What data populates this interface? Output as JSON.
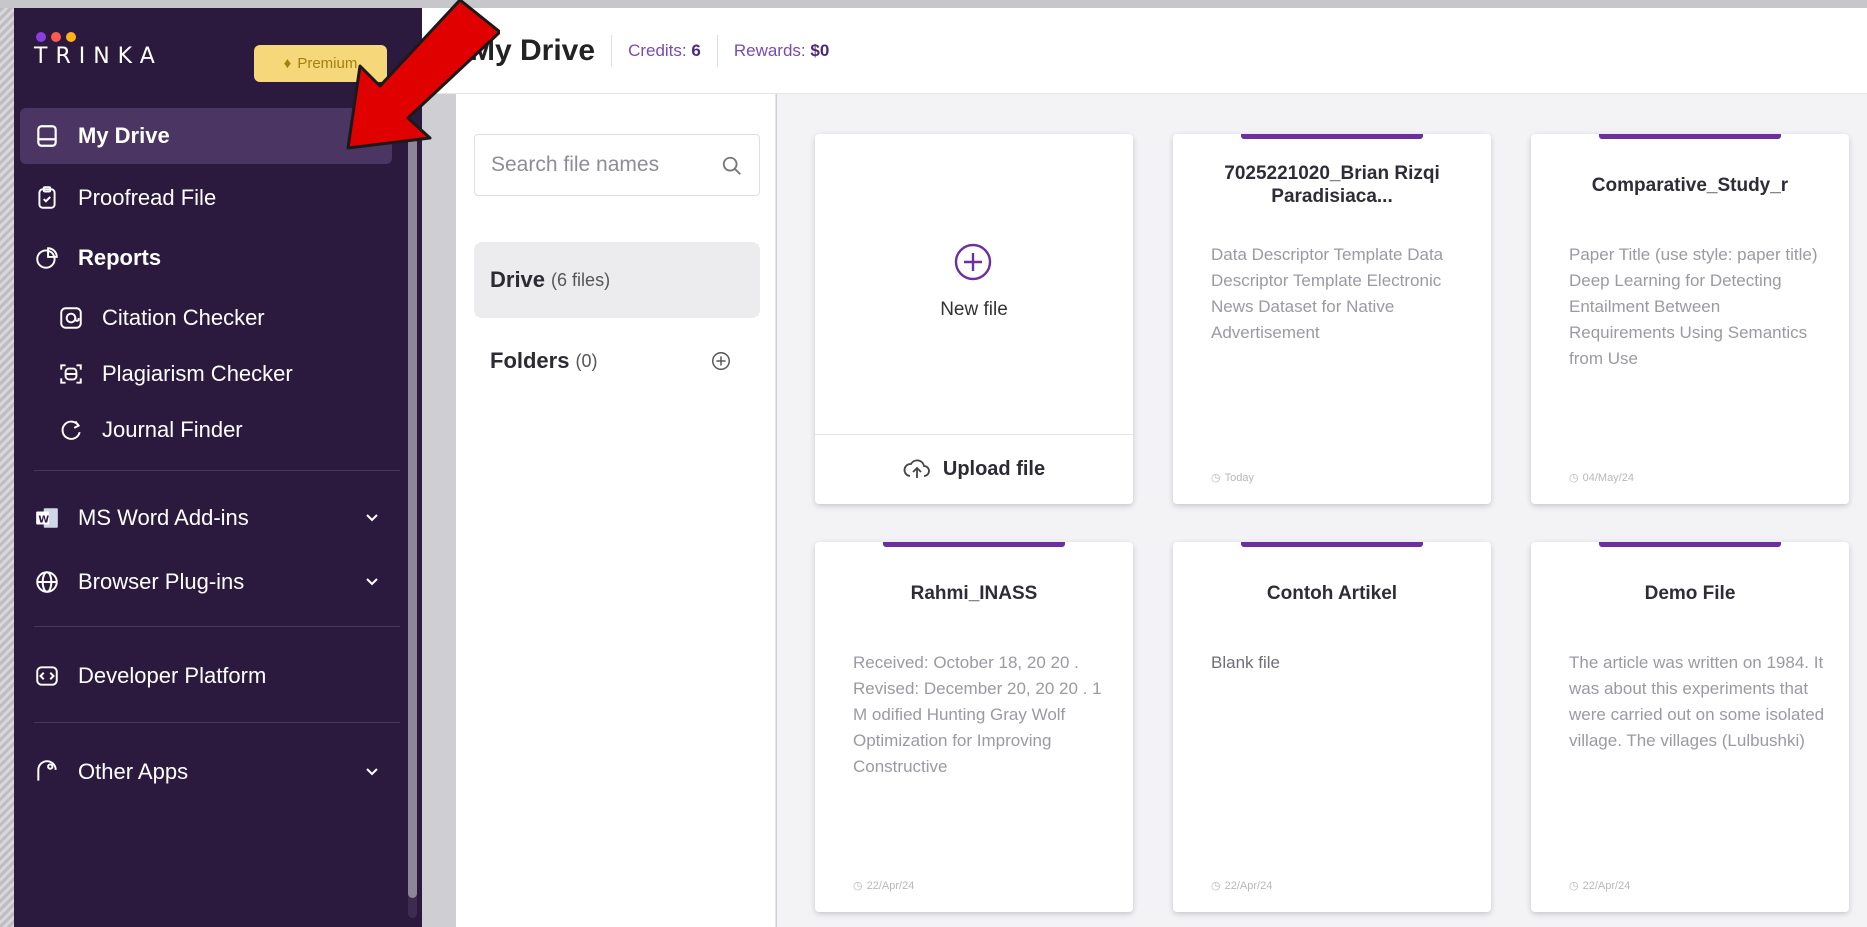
{
  "brand": {
    "name": "TRINKA",
    "premium_label": "Premium",
    "dot_colors": [
      "#8a3ee0",
      "#ff5a4f",
      "#ffb21a"
    ]
  },
  "header": {
    "title": "My Drive",
    "credits_label": "Credits:",
    "credits_value": "6",
    "rewards_label": "Rewards:",
    "rewards_value": "$0"
  },
  "sidebar": {
    "items": [
      {
        "label": "My Drive",
        "icon": "drive-icon",
        "active": true
      },
      {
        "label": "Proofread File",
        "icon": "clipboard-check-icon"
      },
      {
        "label": "Reports",
        "icon": "reports-icon"
      },
      {
        "label": "Citation Checker",
        "icon": "citation-icon"
      },
      {
        "label": "Plagiarism Checker",
        "icon": "plagiarism-icon"
      },
      {
        "label": "Journal Finder",
        "icon": "journal-finder-icon"
      },
      {
        "label": "MS Word Add-ins",
        "icon": "ms-word-icon"
      },
      {
        "label": "Browser Plug-ins",
        "icon": "globe-icon"
      },
      {
        "label": "Developer Platform",
        "icon": "code-icon"
      },
      {
        "label": "Other Apps",
        "icon": "other-apps-icon"
      }
    ]
  },
  "files_panel": {
    "search_placeholder": "Search file names",
    "drive_label": "Drive",
    "drive_count": "(6 files)",
    "folders_label": "Folders",
    "folders_count": "(0)"
  },
  "new_file_card": {
    "new_label": "New file",
    "upload_label": "Upload file"
  },
  "cards": [
    {
      "title": "7025221020_Brian Rizqi Paradisiaca...",
      "body": "Data Descriptor Template Data Descriptor Template Electronic News Dataset for Native Advertisement",
      "date": "Today"
    },
    {
      "title": "Comparative_Study_r",
      "body": "Paper Title (use style: paper title) Deep Learning for Detecting Entailment Between Requirements Using Semantics from Use",
      "date": "04/May/24"
    },
    {
      "title": "Rahmi_INASS",
      "body": "Received: October 18, 20 20 . Revised: December 20, 20 20 . 1 M odified Hunting Gray Wolf Optimization for Improving Constructive",
      "date": "22/Apr/24"
    },
    {
      "title": "Contoh Artikel",
      "body": "Blank file",
      "date": "22/Apr/24"
    },
    {
      "title": "Demo File",
      "body": "The article was written on 1984. It was about this experiments that were carried out on some isolated village. The villages (Lulbushki)",
      "date": "22/Apr/24"
    }
  ],
  "colors": {
    "sidebar_bg": "#2c1a3e",
    "accent": "#6b2f9e",
    "premium_bg": "#f6d77a",
    "annotation_arrow": "#e00000"
  }
}
